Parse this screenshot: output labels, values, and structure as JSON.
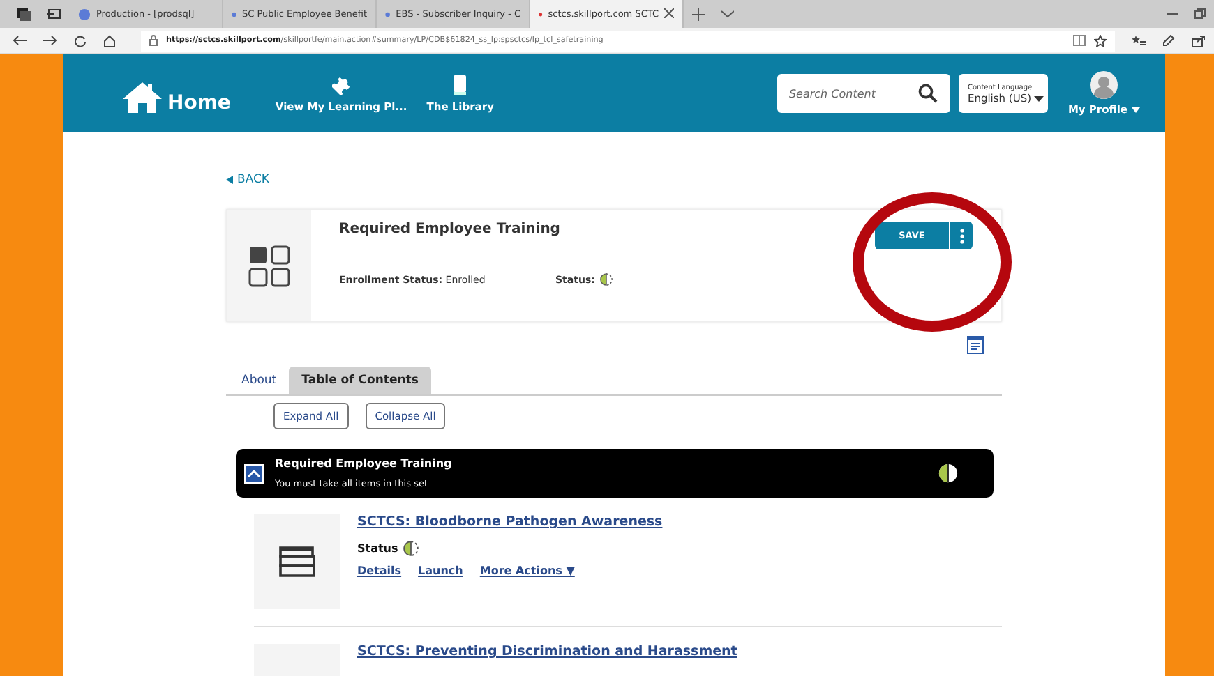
{
  "browser": {
    "tabs": [
      {
        "title": "Production - [prodsql]",
        "selected": false
      },
      {
        "title": "SC Public Employee Benefit",
        "selected": false
      },
      {
        "title": "EBS - Subscriber Inquiry - C",
        "selected": false
      },
      {
        "title": "sctcs.skillport.com SCTC",
        "selected": true
      }
    ],
    "url_host": "https://sctcs.skillport.com",
    "url_path": "/skillportfe/main.action#summary/LP/CDB$61824_ss_lp:spsctcs/lp_tcl_safetraining"
  },
  "header": {
    "home": "Home",
    "nav": [
      {
        "label": "View My Learning Pl..."
      },
      {
        "label": "The Library"
      }
    ],
    "search": {
      "placeholder": "Search Content"
    },
    "language": {
      "label": "Content Language",
      "value": "English (US)"
    },
    "profile": "My Profile"
  },
  "back": "BACK",
  "summary": {
    "title": "Required Employee Training",
    "enrollment_label": "Enrollment Status:",
    "enrollment_value": "Enrolled",
    "status_label": "Status:",
    "save": "SAVE"
  },
  "tabs": [
    {
      "label": "About",
      "selected": false
    },
    {
      "label": "Table of Contents",
      "selected": true
    }
  ],
  "actions": [
    "Expand All",
    "Collapse All"
  ],
  "set": {
    "title": "Required Employee Training",
    "note": "You must take all items in this set",
    "expanded": true
  },
  "items": [
    {
      "title": "SCTCS: Bloodborne Pathogen Awareness",
      "status_label": "Status",
      "links": [
        "Details",
        "Launch",
        "More Actions ▼"
      ]
    },
    {
      "title": "SCTCS: Preventing Discrimination and Harassment"
    }
  ]
}
